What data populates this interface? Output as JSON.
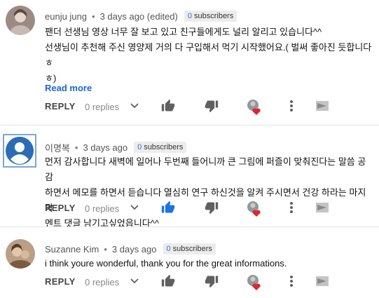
{
  "comments": [
    {
      "author": "eunju jung",
      "time": "3 days ago (edited)",
      "subscribers_count": "0",
      "subscribers_label": "subscribers",
      "lines": [
        "팬더 선생님 영상 너무 잘 보고 있고 친구들에게도 널리 알리고 있습니다^^",
        "선생님이 추천해 주신 영양제 거의 다 구입해서 먹기 시작했어요.( 벌써 좋아진 듯합니다 ㅎ",
        "ㅎ)"
      ],
      "read_more": "Read more",
      "reply_label": "REPLY",
      "replies": "0 replies",
      "liked": false,
      "avatar": "grey-profile-photo"
    },
    {
      "author": "이명복",
      "time": "3 days ago",
      "subscribers_count": "0",
      "subscribers_label": "subscribers",
      "lines": [
        "먼저 감사합니다   새벽에  일어나  두번째  들어니까  큰 그림에 퍼즐이 맞춰진다는 말씀 공감",
        "하면서  메모를  하면서  듣습니다  열심히 연구 하신것을 알켜  주시면서 건강 하라는 마지막",
        "멘트   댓글 남기고싶었읍니다^^"
      ],
      "reply_label": "REPLY",
      "replies": "0 replies",
      "liked": true,
      "avatar": "default-user-avatar"
    },
    {
      "author": "Suzanne Kim",
      "time": "3 days ago",
      "subscribers_count": "0",
      "subscribers_label": "subscribers",
      "lines": [
        "i think youre wonderful, thank you for the great informations."
      ],
      "reply_label": "REPLY",
      "replies": "0 replies",
      "liked": false,
      "avatar": "brown-profile-photo"
    }
  ],
  "colors": {
    "link_blue": "#1a65d6",
    "like_active": "#1a73e8",
    "icon_grey": "#606060",
    "heart_red": "#e0252b",
    "badge_bg": "#ececec"
  }
}
